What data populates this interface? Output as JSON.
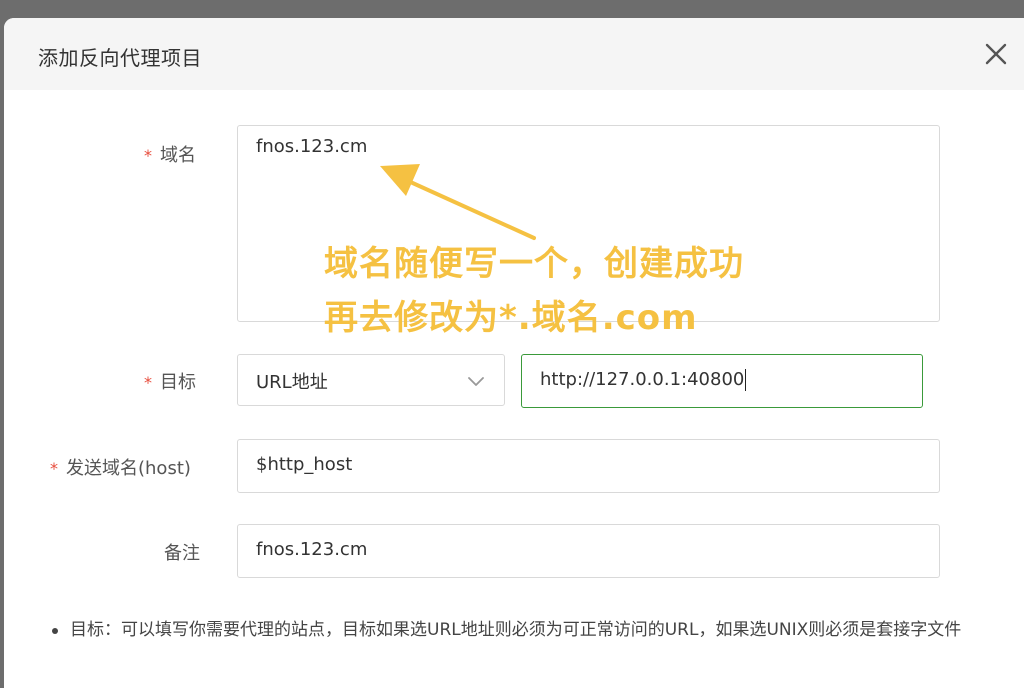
{
  "dialog": {
    "title": "添加反向代理项目"
  },
  "form": {
    "domain": {
      "required_mark": "*",
      "label": "域名",
      "value": "fnos.123.cm"
    },
    "target": {
      "required_mark": "*",
      "label": "目标",
      "type_selected": "URL地址",
      "url_value": "http://127.0.0.1:40800"
    },
    "send_host": {
      "required_mark": "*",
      "label": "发送域名(host)",
      "value": "$http_host"
    },
    "note": {
      "label": "备注",
      "value": "fnos.123.cm"
    }
  },
  "annotation": {
    "line1": "域名随便写一个，创建成功",
    "line2": "再去修改为*.域名.com",
    "color": "#f5c142"
  },
  "hints": {
    "item1": "目标：可以填写你需要代理的站点，目标如果选URL地址则必须为可正常访问的URL，如果选UNIX则必须是套接字文件"
  },
  "colors": {
    "required": "#e74c3c",
    "focus_border": "#3a9a3a",
    "header_bg": "#f5f5f5",
    "backdrop": "#6d6d6d"
  },
  "icons": {
    "close": "close-icon",
    "dropdown": "chevron-down-icon",
    "arrow": "annotation-arrow"
  }
}
